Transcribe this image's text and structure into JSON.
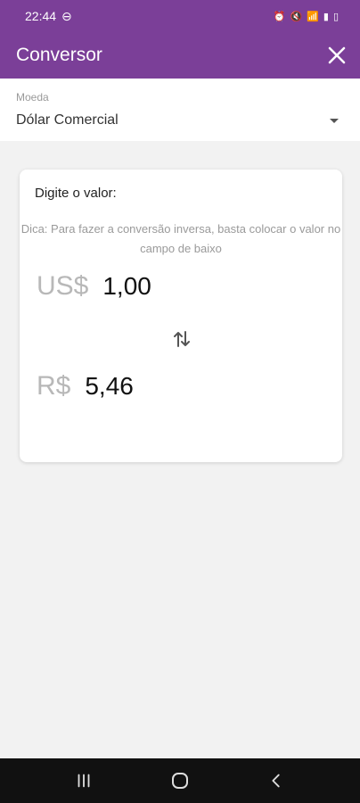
{
  "status": {
    "time": "22:44"
  },
  "appbar": {
    "title": "Conversor"
  },
  "currency": {
    "label": "Moeda",
    "selected": "Dólar Comercial"
  },
  "card": {
    "title": "Digite o valor:",
    "hint": "Dica: Para fazer a conversão inversa, basta colocar o valor no campo de baixo",
    "from": {
      "symbol": "US$",
      "value": "1,00"
    },
    "to": {
      "symbol": "R$",
      "value": "5,46"
    }
  },
  "colors": {
    "primary": "#7b3f98",
    "background": "#f2f2f2"
  },
  "icons": {
    "close": "close-icon",
    "dropdown": "chevron-down-icon",
    "swap": "swap-icon",
    "nav_recent": "recent-apps-icon",
    "nav_home": "home-icon",
    "nav_back": "back-icon"
  }
}
